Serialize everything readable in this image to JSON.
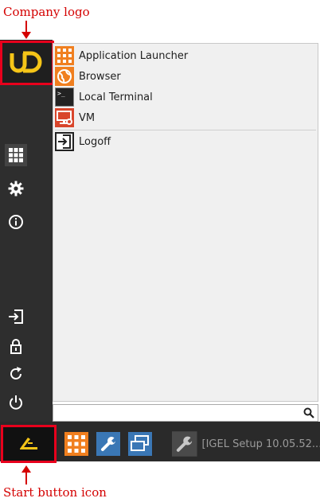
{
  "annotations": {
    "logo_label": "Company logo",
    "start_label": "Start button icon"
  },
  "menu": {
    "items": [
      {
        "label": "Application Launcher",
        "icon": "app-launcher-icon"
      },
      {
        "label": "Browser",
        "icon": "browser-icon"
      },
      {
        "label": "Local Terminal",
        "icon": "terminal-icon"
      },
      {
        "label": "VM",
        "icon": "vm-icon"
      }
    ],
    "logoff": {
      "label": "Logoff",
      "icon": "logoff-icon"
    }
  },
  "search": {
    "value": "",
    "placeholder": ""
  },
  "taskbar": {
    "task_label": "[IGEL Setup 10.05.52..."
  },
  "colors": {
    "annotation_red": "#d40000",
    "logo_yellow": "#f5c518",
    "launcher_orange": "#f07f1f",
    "setup_blue": "#3a77b5"
  }
}
